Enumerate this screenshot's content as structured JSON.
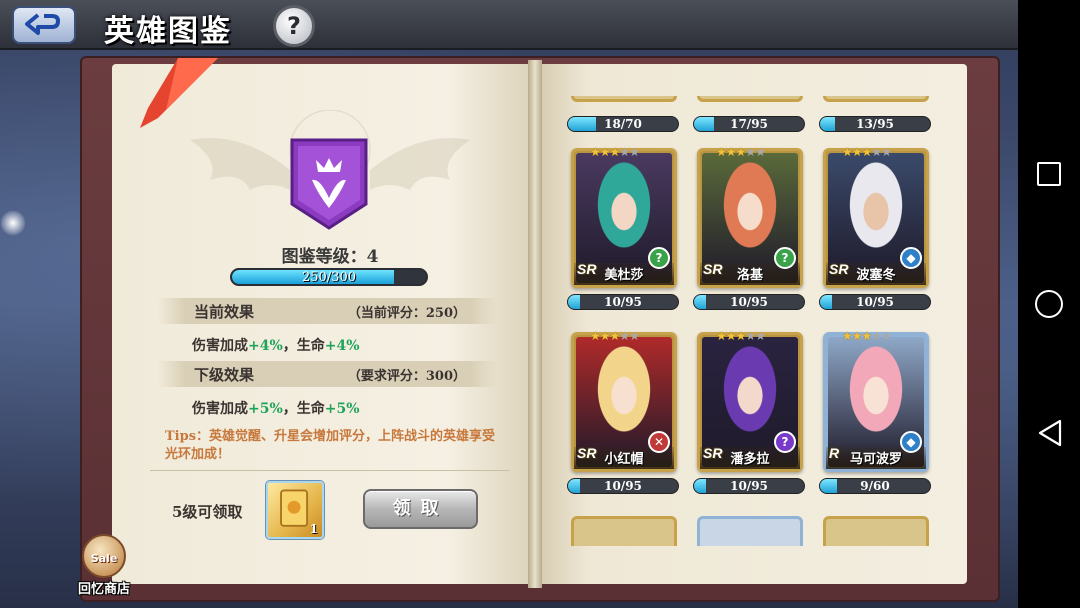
{
  "header": {
    "title": "英雄图鉴",
    "help_glyph": "?"
  },
  "collection": {
    "level_label": "图鉴等级：4",
    "progress_text": "250/300",
    "progress_fraction": 0.833,
    "current_effect": {
      "title": "当前效果",
      "score": "（当前评分：250）",
      "line_prefix": "伤害加成",
      "damage": "+4%",
      "sep": "，生命",
      "hp": "+4%"
    },
    "next_effect": {
      "title": "下级效果",
      "score": "（要求评分：300）",
      "line_prefix": "伤害加成",
      "damage": "+5%",
      "sep": "，生命",
      "hp": "+5%"
    },
    "tips": "Tips：英雄觉醒、升星会增加评分，上阵战斗的英雄享受光环加成！",
    "reward_label": "5级可领取",
    "reward_count": "1",
    "claim_label": "领取"
  },
  "shop": {
    "sale_badge": "Sale",
    "label": "回忆商店"
  },
  "heroes_top_row": [
    {
      "fragments": "18/70",
      "fill": 0.257
    },
    {
      "fragments": "17/95",
      "fill": 0.179
    },
    {
      "fragments": "13/95",
      "fill": 0.137
    }
  ],
  "heroes": [
    {
      "name": "美杜莎",
      "rank": "SR",
      "stars": 3,
      "class_icon": "?",
      "class_color": "#3aa34a",
      "fragments": "10/95",
      "fill": 0.105,
      "frame": "gold",
      "hair": "#2fa89a",
      "skin": "#f3d6c4",
      "bg": "#4a3a60"
    },
    {
      "name": "洛基",
      "rank": "SR",
      "stars": 3,
      "class_icon": "?",
      "class_color": "#3aa34a",
      "fragments": "10/95",
      "fill": 0.105,
      "frame": "gold",
      "hair": "#e07a55",
      "skin": "#f6dccb",
      "bg": "#5a6a3a"
    },
    {
      "name": "波塞冬",
      "rank": "SR",
      "stars": 3,
      "class_icon": "◆",
      "class_color": "#2f7fc9",
      "fragments": "10/95",
      "fill": 0.105,
      "frame": "gold",
      "hair": "#e8e8ee",
      "skin": "#e8c4a8",
      "bg": "#3a4a6a"
    },
    {
      "name": "小红帽",
      "rank": "SR",
      "stars": 3,
      "class_icon": "✕",
      "class_color": "#c03a3a",
      "fragments": "10/95",
      "fill": 0.105,
      "frame": "gold",
      "hair": "#f2d58a",
      "skin": "#f7e0cf",
      "bg": "#b02a2a"
    },
    {
      "name": "潘多拉",
      "rank": "SR",
      "stars": 3,
      "class_icon": "?",
      "class_color": "#7a3ac9",
      "fragments": "10/95",
      "fill": 0.105,
      "frame": "gold",
      "hair": "#6a3ab0",
      "skin": "#f3d8cc",
      "bg": "#2a2340"
    },
    {
      "name": "马可波罗",
      "rank": "R",
      "stars": 3,
      "class_icon": "◆",
      "class_color": "#2f7fc9",
      "fragments": "9/60",
      "fill": 0.15,
      "frame": "blue",
      "hair": "#f2a8b8",
      "skin": "#f8e2d6",
      "bg": "#8fa8c8"
    }
  ],
  "nav": {
    "icons": [
      "recent-apps-icon",
      "home-icon",
      "back-triangle-icon"
    ]
  }
}
